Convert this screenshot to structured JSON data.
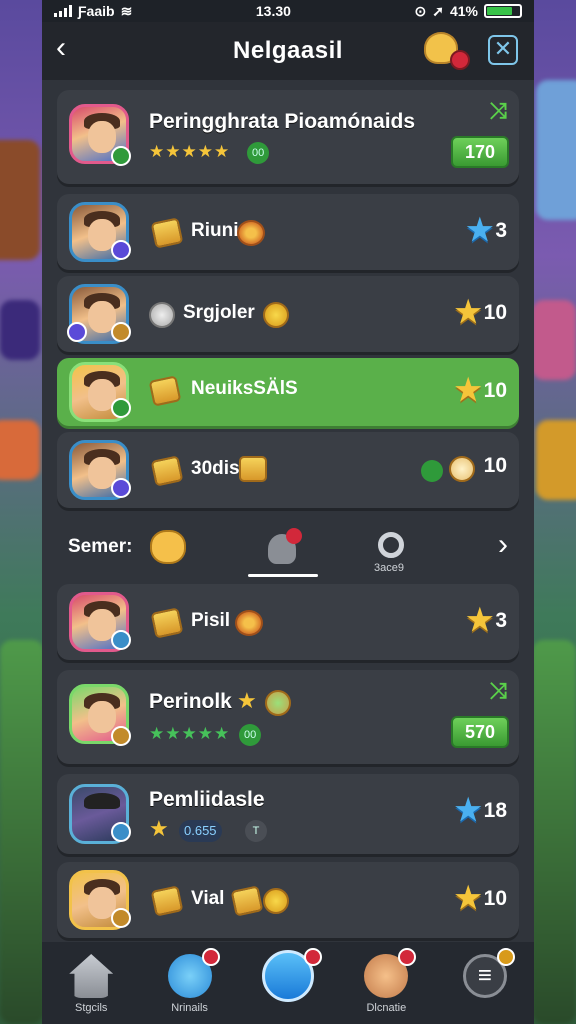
{
  "status_bar": {
    "carrier": "Ƒaaib",
    "time": "13.30",
    "battery": "41%"
  },
  "header": {
    "title": "Nelgaasil"
  },
  "rows": [
    {
      "name": "Peringghrata Pioamónaids",
      "tag": "00",
      "score": "170"
    },
    {
      "item": "Riuni",
      "rank": "3"
    },
    {
      "item": "Srgjoler",
      "rank": "10"
    },
    {
      "item": "NeuiksSÄlS",
      "rank": "10"
    },
    {
      "item": "30dis",
      "rank": "10"
    }
  ],
  "section": {
    "label": "Semer:",
    "ring_caption": "3ace9"
  },
  "rows2": [
    {
      "item": "Pisil",
      "rank": "3"
    },
    {
      "name": "Perinolk",
      "tag": "00",
      "score": "570"
    },
    {
      "name": "Pemliidasle",
      "pill": "0.655",
      "pill2": "T",
      "rank": "18"
    },
    {
      "item": "Vial",
      "rank": "10"
    }
  ],
  "bottom_nav": [
    {
      "label": "Stgcils"
    },
    {
      "label": "Nrinails"
    },
    {
      "label": ""
    },
    {
      "label": "Dlcnatie"
    },
    {
      "label": ""
    }
  ]
}
